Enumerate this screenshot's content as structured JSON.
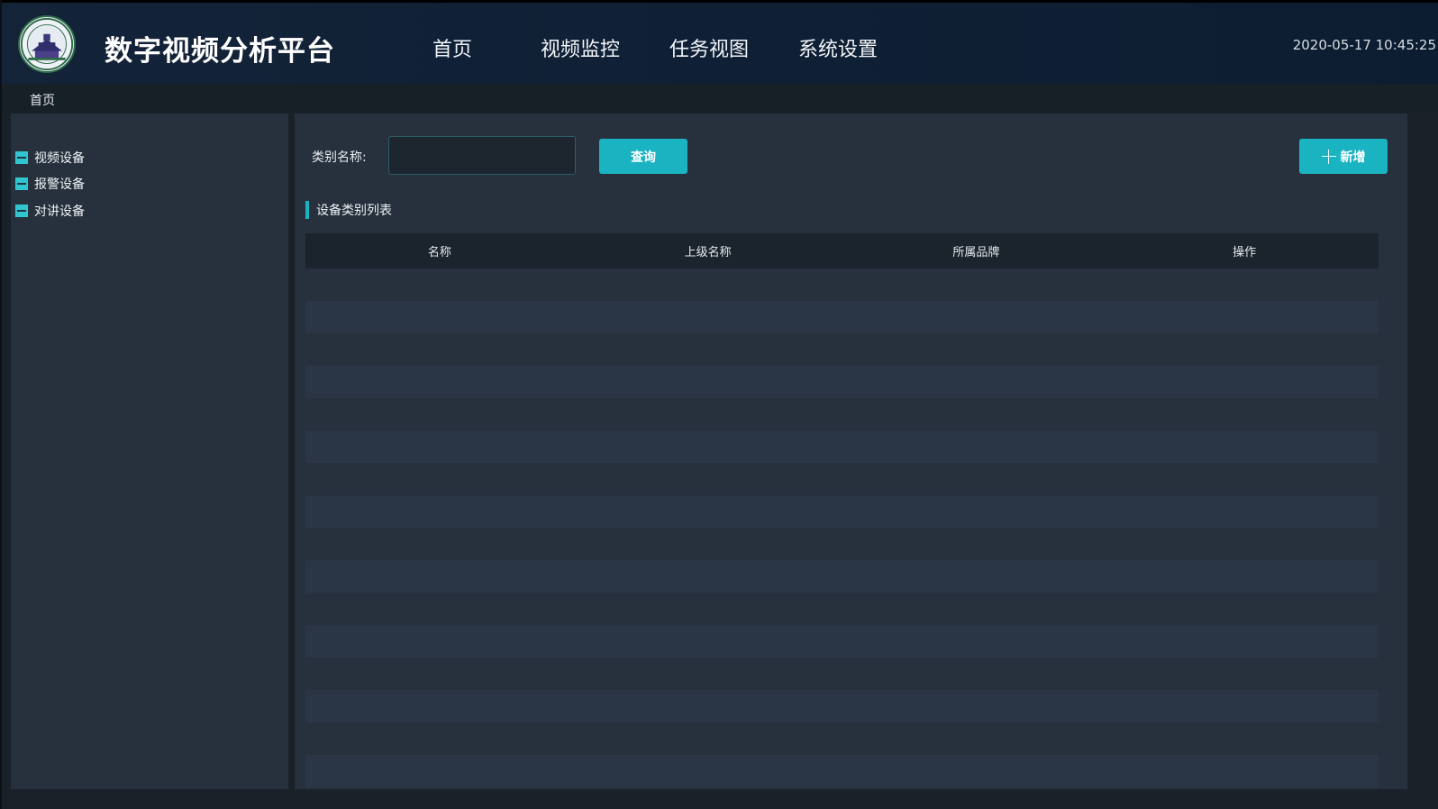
{
  "app": {
    "title": "数字视频分析平台",
    "logo_icon": "university-seal-icon"
  },
  "nav": {
    "items": [
      {
        "label": "首页"
      },
      {
        "label": "视频监控"
      },
      {
        "label": "任务视图"
      },
      {
        "label": "系统设置"
      }
    ]
  },
  "clock": "2020-05-17 10:45:25",
  "breadcrumb": "首页",
  "sidebar": {
    "items": [
      {
        "label": "视频设备",
        "icon": "collapse-box-icon"
      },
      {
        "label": "报警设备",
        "icon": "collapse-box-icon"
      },
      {
        "label": "对讲设备",
        "icon": "collapse-box-icon"
      }
    ]
  },
  "filter": {
    "label": "类别名称:",
    "input_value": "",
    "query_button": "查询",
    "add_button": "新增",
    "add_icon": "plus-icon"
  },
  "table": {
    "section_title": "设备类别列表",
    "columns": [
      "名称",
      "上级名称",
      "所属品牌",
      "操作"
    ],
    "rows": []
  },
  "colors": {
    "accent": "#1ab3c1",
    "header_bg": "#132338",
    "panel_bg": "#26313d",
    "tree_box": "#31c6cf"
  }
}
